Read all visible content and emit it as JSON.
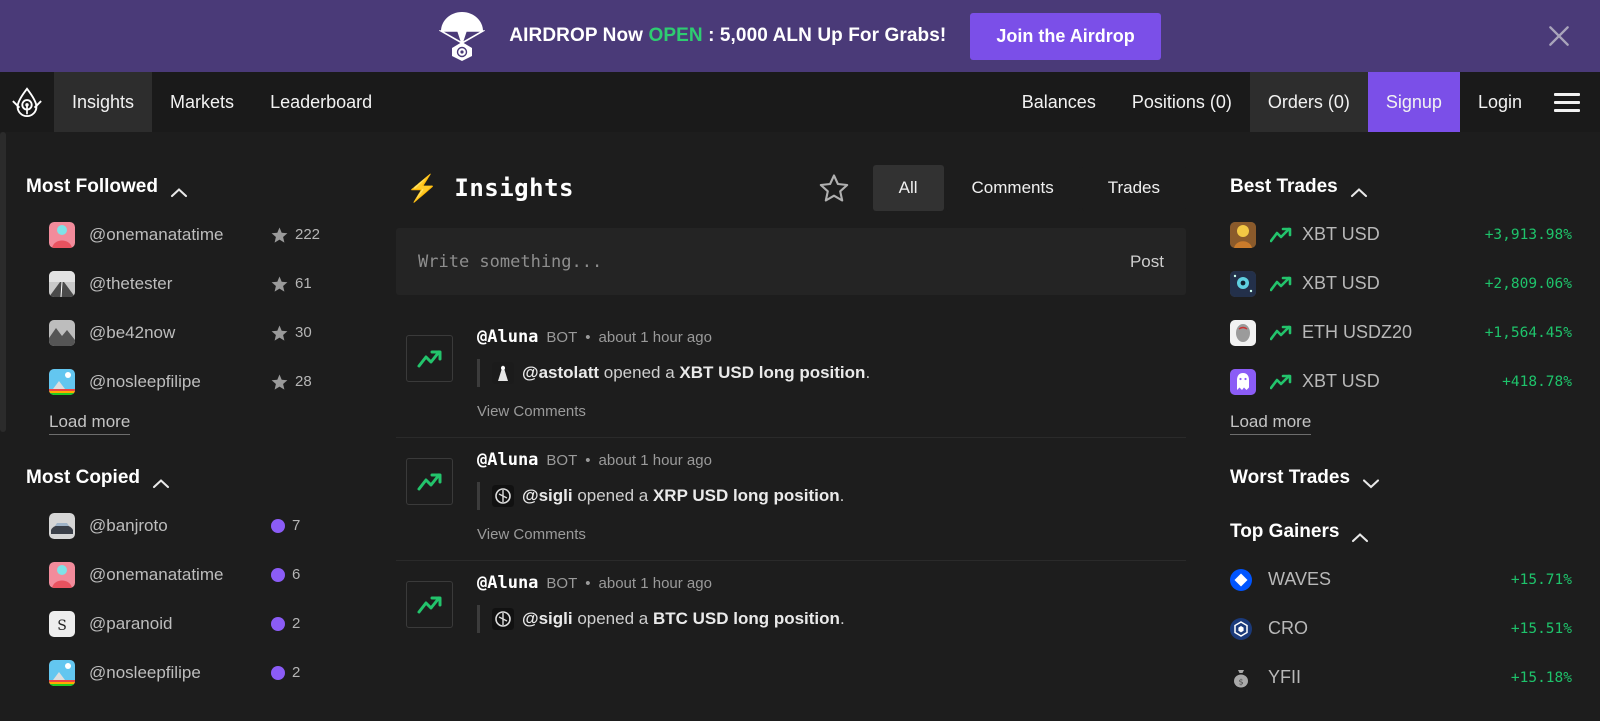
{
  "banner": {
    "icon": "parachute-icon",
    "text_before": "AIRDROP Now ",
    "text_open": "OPEN",
    "text_after": " : 5,000 ALN Up For Grabs!",
    "cta_label": "Join the Airdrop",
    "close_icon": "close-icon",
    "bg_color": "#4a3a78",
    "cta_color": "#7b4fe8",
    "open_color": "#2ecc71"
  },
  "navbar": {
    "brand_icon": "aluna-logo-icon",
    "left_items": [
      {
        "label": "Insights",
        "active": true
      },
      {
        "label": "Markets",
        "active": false
      },
      {
        "label": "Leaderboard",
        "active": false
      }
    ],
    "right_items": [
      {
        "label": "Balances",
        "style": "plain"
      },
      {
        "label": "Positions (0)",
        "style": "plain"
      },
      {
        "label": "Orders (0)",
        "style": "active"
      },
      {
        "label": "Signup",
        "style": "signup"
      },
      {
        "label": "Login",
        "style": "plain"
      }
    ],
    "menu_icon": "hamburger-menu-icon"
  },
  "left_sidebar": {
    "most_followed": {
      "title": "Most Followed",
      "chevron": "chevron-up-icon",
      "items": [
        {
          "user": "@onemanatatime",
          "count": "222",
          "metric_icon": "star-icon",
          "avatar": "av-anime"
        },
        {
          "user": "@thetester",
          "count": "61",
          "metric_icon": "star-icon",
          "avatar": "av-road"
        },
        {
          "user": "@be42now",
          "count": "30",
          "metric_icon": "star-icon",
          "avatar": "av-mountain"
        },
        {
          "user": "@nosleepfilipe",
          "count": "28",
          "metric_icon": "star-icon",
          "avatar": "av-rainbow"
        }
      ],
      "load_more": "Load more"
    },
    "most_copied": {
      "title": "Most Copied",
      "chevron": "chevron-up-icon",
      "items": [
        {
          "user": "@banjroto",
          "count": "7",
          "metric_icon": "copy-dot-icon",
          "avatar": "av-car"
        },
        {
          "user": "@onemanatatime",
          "count": "6",
          "metric_icon": "copy-dot-icon",
          "avatar": "av-anime"
        },
        {
          "user": "@paranoid",
          "count": "2",
          "metric_icon": "copy-dot-icon",
          "avatar": "av-dollar"
        },
        {
          "user": "@nosleepfilipe",
          "count": "2",
          "metric_icon": "copy-dot-icon",
          "avatar": "av-rainbow"
        }
      ]
    }
  },
  "main": {
    "bolt_icon": "lightning-bolt-icon",
    "title": "Insights",
    "favorite_icon": "star-outline-icon",
    "tabs": [
      {
        "label": "All",
        "active": true
      },
      {
        "label": "Comments",
        "active": false
      },
      {
        "label": "Trades",
        "active": false
      }
    ],
    "composer": {
      "placeholder": "Write something...",
      "value": "",
      "post_label": "Post"
    },
    "feed": [
      {
        "type_icon": "trend-up-icon",
        "author": "@Aluna",
        "badge": "BOT",
        "separator": "•",
        "time": "about 1 hour ago",
        "avatar": "av-astolatt",
        "actor": "@astolatt",
        "action": " opened a ",
        "subject": "XBT USD long position",
        "period": ".",
        "comments_label": "View Comments"
      },
      {
        "type_icon": "trend-up-icon",
        "author": "@Aluna",
        "badge": "BOT",
        "separator": "•",
        "time": "about 1 hour ago",
        "avatar": "av-sigli",
        "actor": "@sigli",
        "action": " opened a ",
        "subject": "XRP USD long position",
        "period": ".",
        "comments_label": "View Comments"
      },
      {
        "type_icon": "trend-up-icon",
        "author": "@Aluna",
        "badge": "BOT",
        "separator": "•",
        "time": "about 1 hour ago",
        "avatar": "av-sigli",
        "actor": "@sigli",
        "action": " opened a ",
        "subject": "BTC USD long position",
        "period": ".",
        "comments_label": ""
      }
    ]
  },
  "right_sidebar": {
    "best_trades": {
      "title": "Best Trades",
      "chevron": "chevron-up-icon",
      "items": [
        {
          "pair": "XBT USD",
          "pct": "+3,913.98%",
          "avatar": "av-yellowhair",
          "dir_icon": "trend-up-icon"
        },
        {
          "pair": "XBT USD",
          "pct": "+2,809.06%",
          "avatar": "av-space",
          "dir_icon": "trend-up-icon"
        },
        {
          "pair": "ETH USDZ20",
          "pct": "+1,564.45%",
          "avatar": "av-face",
          "dir_icon": "trend-up-icon"
        },
        {
          "pair": "XBT USD",
          "pct": "+418.78%",
          "avatar": "av-ghost",
          "dir_icon": "trend-up-icon"
        }
      ],
      "load_more": "Load more"
    },
    "worst_trades": {
      "title": "Worst Trades",
      "chevron": "chevron-down-icon"
    },
    "top_gainers": {
      "title": "Top Gainers",
      "chevron": "chevron-up-icon",
      "items": [
        {
          "symbol": "WAVES",
          "pct": "+15.71%",
          "icon": "waves-coin-icon"
        },
        {
          "symbol": "CRO",
          "pct": "+15.51%",
          "icon": "cro-coin-icon"
        },
        {
          "symbol": "YFII",
          "pct": "+15.18%",
          "icon": "yfii-coin-icon"
        }
      ]
    }
  },
  "colors": {
    "page_bg": "#1d1d1d",
    "nav_bg": "#1a1a1a",
    "accent_purple": "#7b4fe8",
    "positive_green": "#1ec36b",
    "panel": "#242424"
  }
}
